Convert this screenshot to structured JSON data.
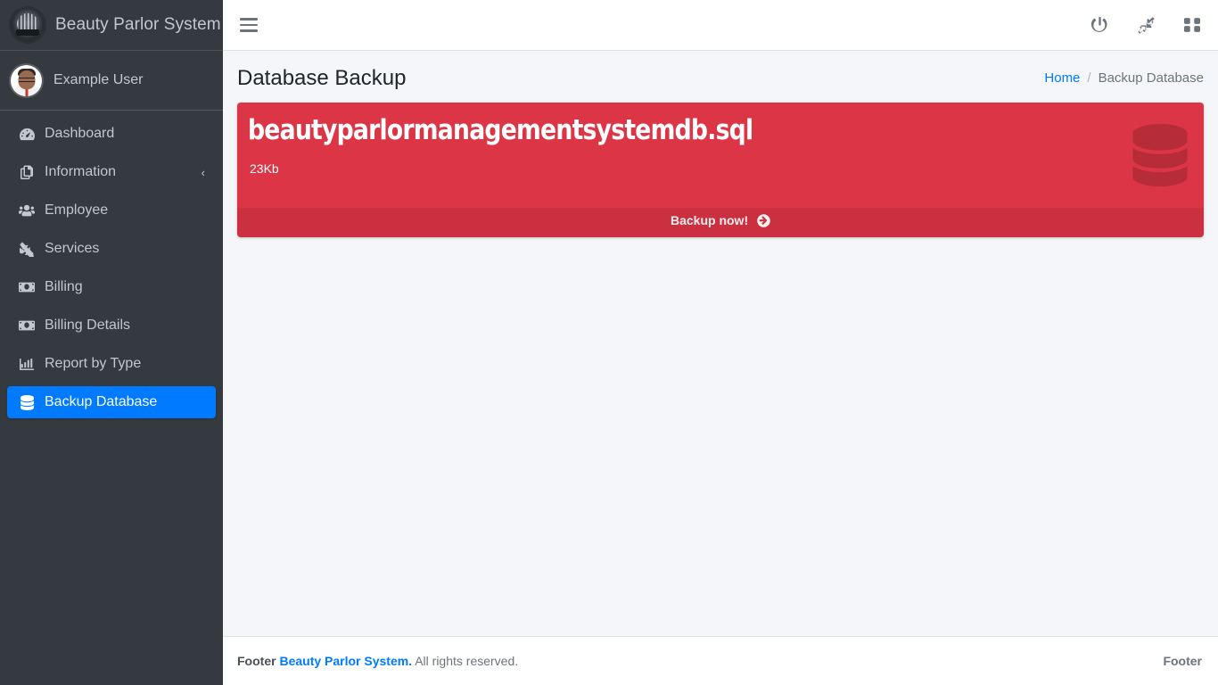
{
  "brand": {
    "title": "Beauty Parlor System",
    "logo_icon": "parlor-logo-badge"
  },
  "user_panel": {
    "name": "Example User",
    "avatar_icon": "user-avatar"
  },
  "sidebar": {
    "items": [
      {
        "label": "Dashboard",
        "icon": "tachometer-icon",
        "active": false,
        "has_arrow": false
      },
      {
        "label": "Information",
        "icon": "copy-files-icon",
        "active": false,
        "has_arrow": true
      },
      {
        "label": "Employee",
        "icon": "users-icon",
        "active": false,
        "has_arrow": false
      },
      {
        "label": "Services",
        "icon": "tools-icon",
        "active": false,
        "has_arrow": false
      },
      {
        "label": "Billing",
        "icon": "money-bill-icon",
        "active": false,
        "has_arrow": false
      },
      {
        "label": "Billing Details",
        "icon": "money-bill-icon",
        "active": false,
        "has_arrow": false
      },
      {
        "label": "Report by Type",
        "icon": "chart-bar-icon",
        "active": false,
        "has_arrow": false
      },
      {
        "label": "Backup Database",
        "icon": "database-icon",
        "active": true,
        "has_arrow": false
      }
    ],
    "collapse_arrow": "‹"
  },
  "navbar": {
    "menu_toggle_icon": "hamburger-icon",
    "buttons": [
      {
        "icon": "power-icon"
      },
      {
        "icon": "compress-arrows-icon"
      },
      {
        "icon": "th-grid-icon"
      }
    ]
  },
  "main": {
    "page_title": "Database Backup",
    "breadcrumb": {
      "home": "Home",
      "separator": "/",
      "current": "Backup Database"
    },
    "backup_card": {
      "filename": "beautyparlormanagementsystemdb.sql",
      "filesize": "23Kb",
      "action_label": "Backup now!",
      "action_icon": "arrow-circle-right-icon",
      "deco_icon": "database-icon",
      "color": "#dc3545"
    }
  },
  "footer": {
    "prefix": "Footer",
    "brand_link": "Beauty Parlor System.",
    "rights": "All rights reserved.",
    "right_label": "Footer"
  },
  "colors": {
    "sidebar_bg": "#343a40",
    "accent_blue": "#007bff",
    "danger_red": "#dc3545",
    "content_bg": "#f4f6f9"
  }
}
